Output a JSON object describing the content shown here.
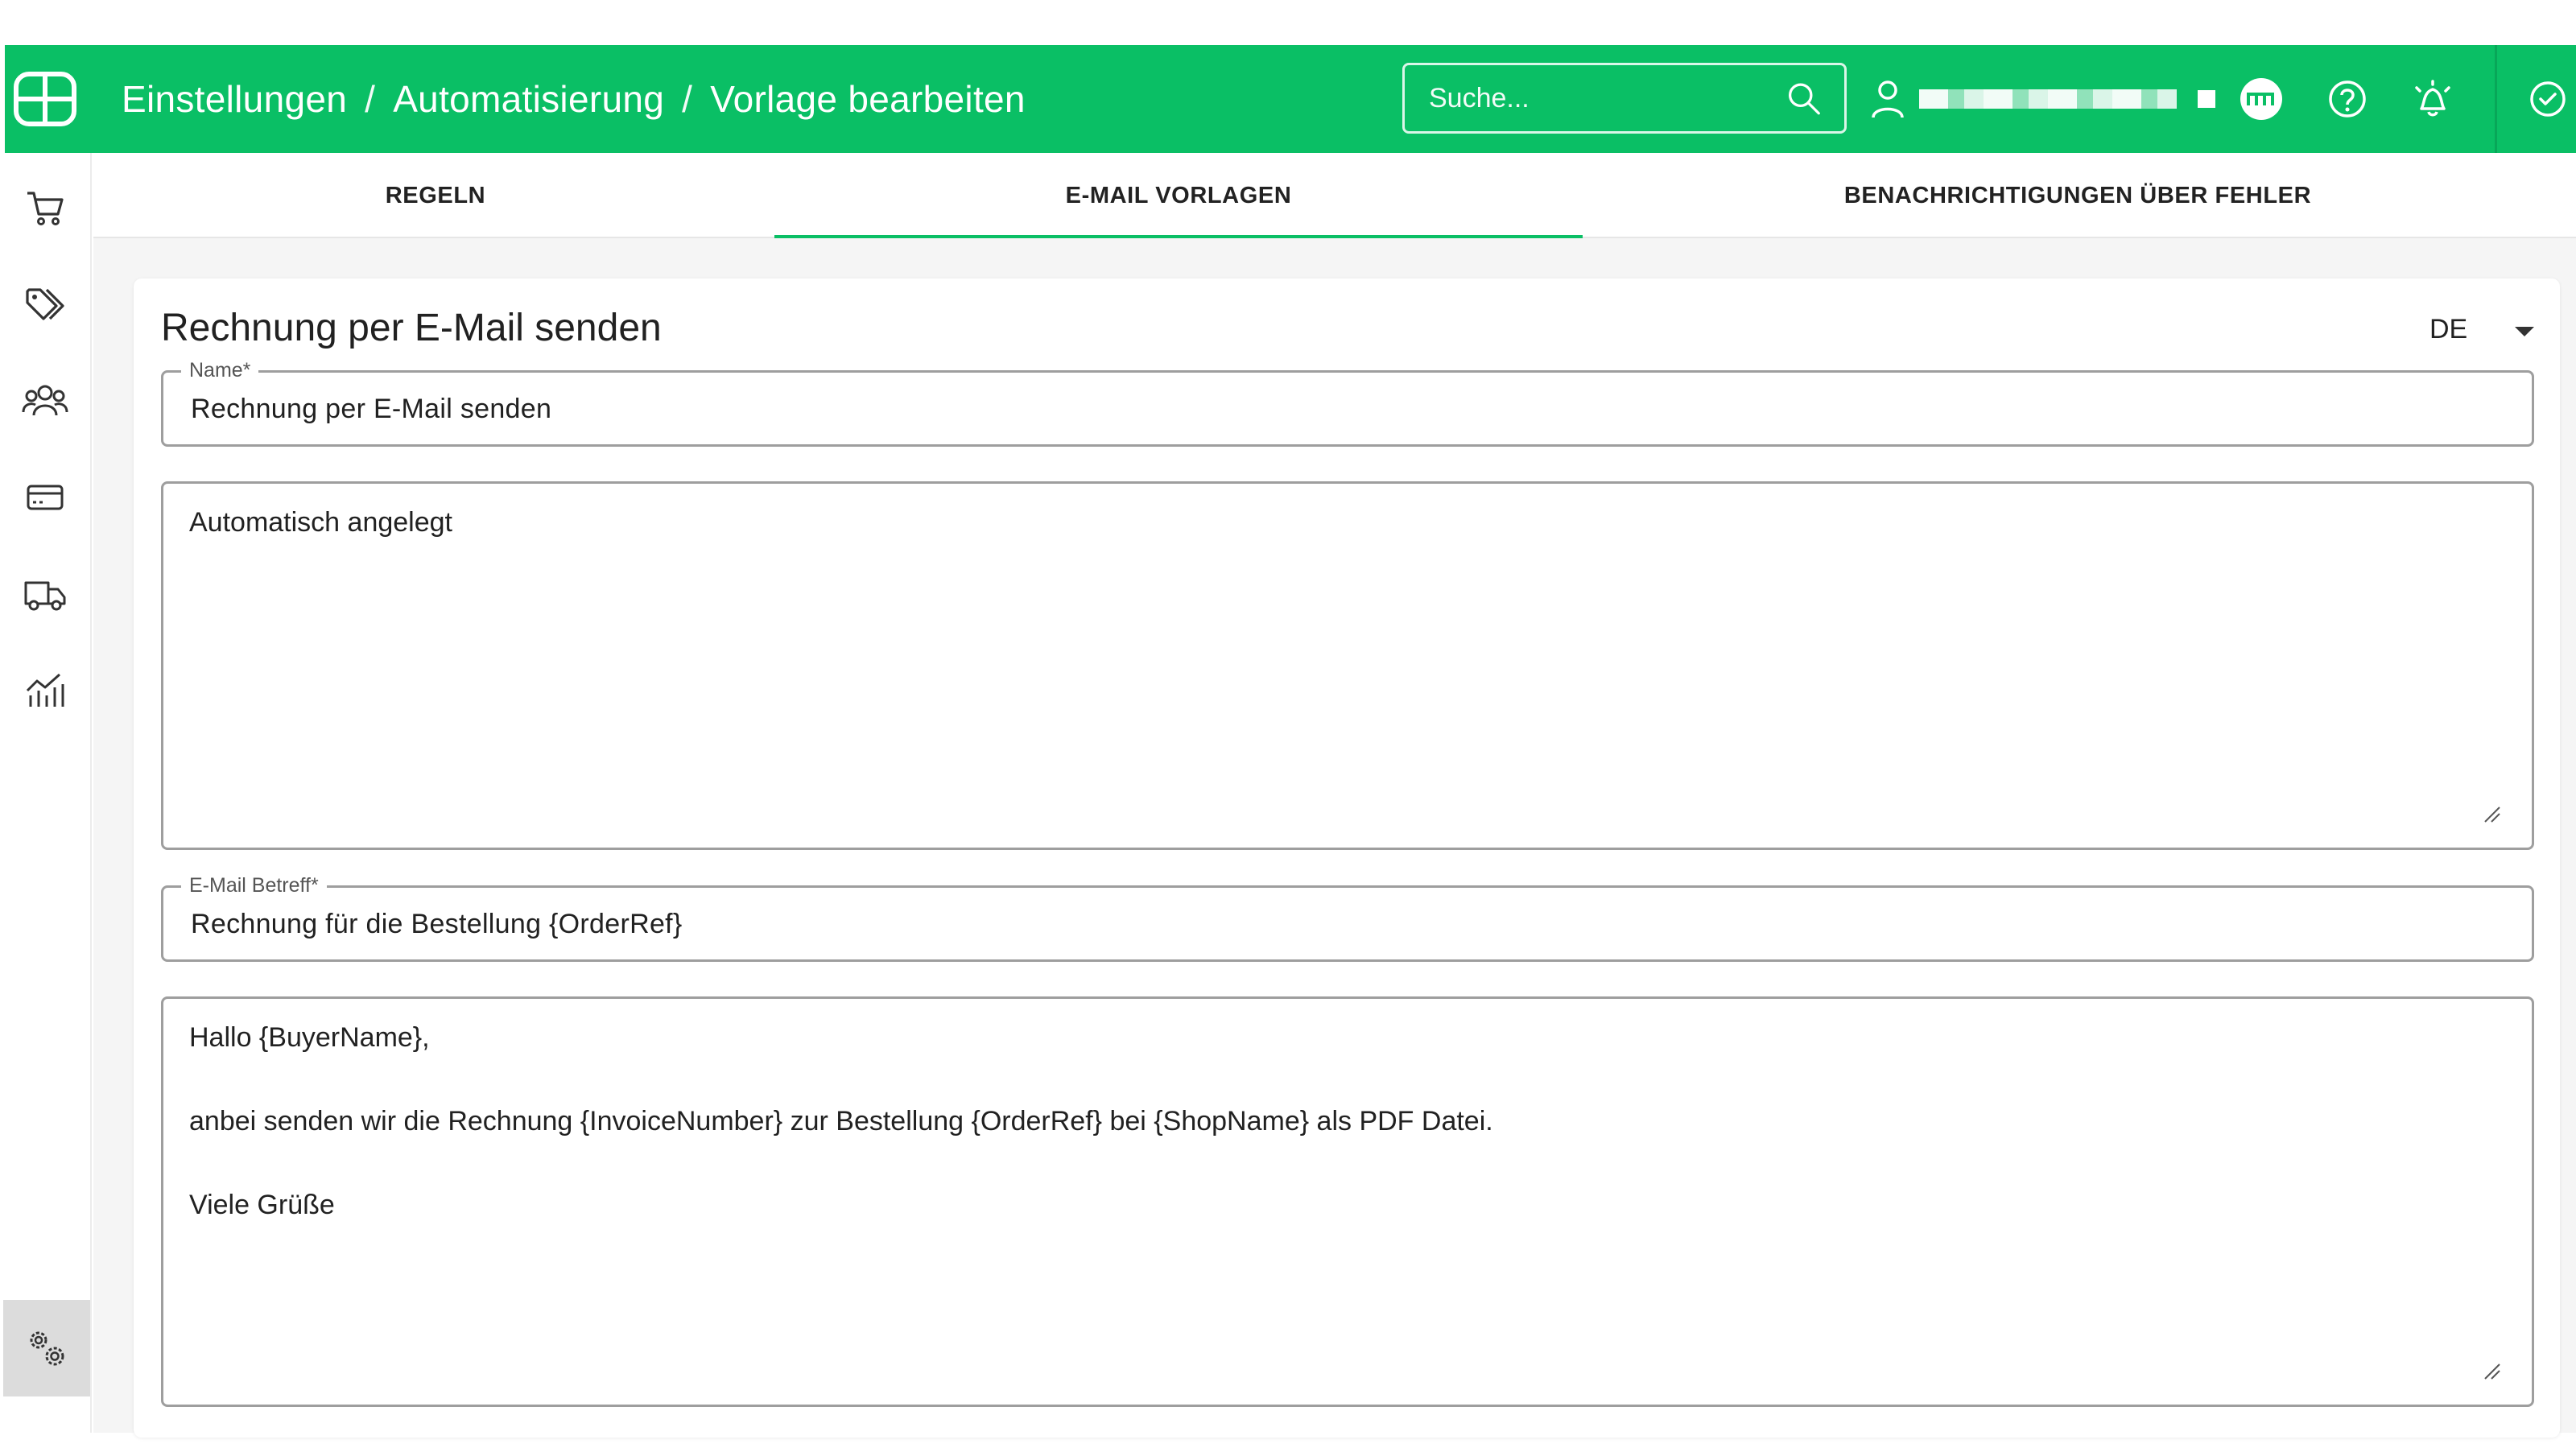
{
  "header": {
    "breadcrumb": [
      "Einstellungen",
      "Automatisierung",
      "Vorlage bearbeiten"
    ],
    "separator": "/",
    "search_placeholder": "Suche...",
    "brand_color": "#0abf65"
  },
  "tabs": [
    {
      "label": "REGELN",
      "active": false
    },
    {
      "label": "E-MAIL VORLAGEN",
      "active": true
    },
    {
      "label": "BENACHRICHTIGUNGEN ÜBER FEHLER",
      "active": false
    }
  ],
  "sidebar": {
    "items": [
      {
        "icon": "cart-icon"
      },
      {
        "icon": "tags-icon"
      },
      {
        "icon": "customers-icon"
      },
      {
        "icon": "payment-card-icon"
      },
      {
        "icon": "shipping-truck-icon"
      },
      {
        "icon": "analytics-icon"
      },
      {
        "icon": "settings-gears-icon",
        "active": true
      }
    ]
  },
  "form": {
    "title": "Rechnung per E-Mail senden",
    "language": "DE",
    "name_label": "Name*",
    "name_value": "Rechnung per E-Mail senden",
    "description_value": "Automatisch angelegt",
    "subject_label": "E-Mail Betreff*",
    "subject_value": "Rechnung für die Bestellung {OrderRef}",
    "body_value": "Hallo {BuyerName},\n\nanbei senden wir die Rechnung {InvoiceNumber} zur Bestellung {OrderRef} bei {ShopName} als PDF Datei.\n\nViele Grüße"
  }
}
